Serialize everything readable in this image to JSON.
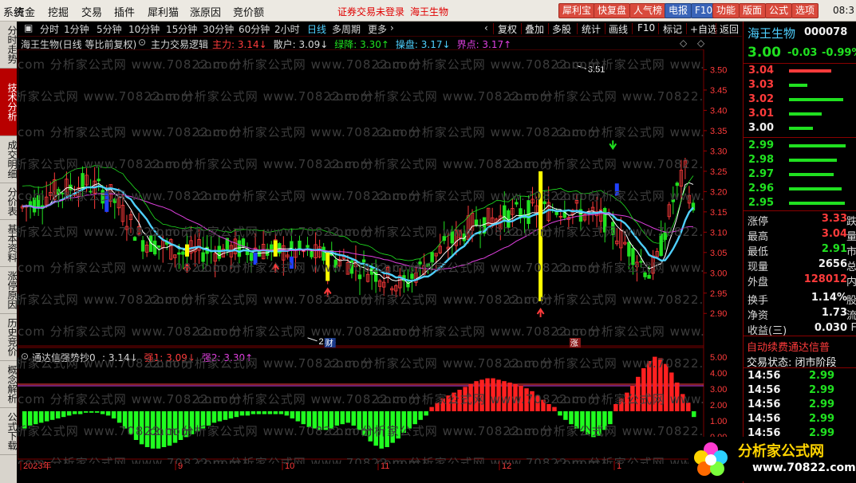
{
  "menubar": {
    "items": [
      "系统",
      "资金",
      "挖掘",
      "交易",
      "插件",
      "犀利猫",
      "涨原因",
      "竞价额"
    ],
    "login_notice": "证券交易未登录",
    "stock_name": "海王生物",
    "top_buttons": [
      "犀利宝",
      "快复盘",
      "人气榜",
      "电报",
      "F10",
      "功能",
      "版面",
      "公式",
      "选项"
    ],
    "clock": "08:3"
  },
  "left_tabs": [
    "分时走势",
    "技术分析",
    "成交明细",
    "分价表",
    "基本资料",
    "涨停原因",
    "历史竞价",
    "概念解析",
    "公式下载"
  ],
  "period_bar": {
    "periods": [
      "分时",
      "1分钟",
      "5分钟",
      "10分钟",
      "15分钟",
      "30分钟",
      "60分钟",
      "2小时",
      "日线",
      "多周期",
      "更多"
    ],
    "active": "日线",
    "right_buttons": [
      "复权",
      "叠加",
      "多股",
      "统计",
      "画线",
      "F10",
      "标记",
      "+自选",
      "返回"
    ]
  },
  "indicator_main": {
    "title": "海王生物(日线 等比前复权)",
    "formula": "主力交易逻辑",
    "items": [
      {
        "label": "主力:",
        "value": "3.14",
        "arrow": "↓",
        "color": "#ff3b3b"
      },
      {
        "label": "散户:",
        "value": "3.09",
        "arrow": "↓",
        "color": "#d8d8d8"
      },
      {
        "label": "绿降:",
        "value": "3.30",
        "arrow": "↑",
        "color": "#20e020"
      },
      {
        "label": "操盘:",
        "value": "3.17",
        "arrow": "↓",
        "color": "#4fd0ff"
      },
      {
        "label": "界点:",
        "value": "3.17",
        "arrow": "↑",
        "color": "#e040e0"
      }
    ]
  },
  "indicator_sub": {
    "formula": "通达信强势抄0",
    "items": [
      {
        "label": ":",
        "value": "3.14",
        "arrow": "↓",
        "color": "#d8d8d8"
      },
      {
        "label": "强1:",
        "value": "3.09",
        "arrow": "↓",
        "color": "#ff3b3b"
      },
      {
        "label": "强2:",
        "value": "3.30",
        "arrow": "↑",
        "color": "#e040e0"
      }
    ]
  },
  "price_axis": [
    "3.50",
    "3.45",
    "3.40",
    "3.35",
    "3.30",
    "3.25",
    "3.20",
    "3.15",
    "3.10",
    "3.05",
    "3.00",
    "2.95",
    "2.90"
  ],
  "sub_axis": [
    "5.00",
    "4.00",
    "3.00",
    "2.00",
    "1.00",
    "0.00"
  ],
  "date_axis": [
    "2023年",
    "9",
    "10",
    "11",
    "12",
    "1"
  ],
  "annotations": {
    "high_label": "3.51",
    "low_label": "2.84",
    "tag_cai": "财",
    "tag_zhang": "涨"
  },
  "watermark": "com 分析家公式网 www.70822.com",
  "quote": {
    "name": "海王生物",
    "code": "000078",
    "price": "3.00",
    "change": "-0.03",
    "pct": "-0.99%",
    "asks": [
      {
        "price": "3.04",
        "bar": 70
      },
      {
        "price": "3.03",
        "bar": 30
      },
      {
        "price": "3.02",
        "bar": 90
      },
      {
        "price": "3.01",
        "bar": 55
      },
      {
        "price": "3.00",
        "bar": 40
      }
    ],
    "bids": [
      {
        "price": "2.99",
        "bar": 95
      },
      {
        "price": "2.98",
        "bar": 80
      },
      {
        "price": "2.97",
        "bar": 75
      },
      {
        "price": "2.96",
        "bar": 88
      },
      {
        "price": "2.95",
        "bar": 93
      }
    ],
    "stats": [
      {
        "label": "涨停",
        "value": "3.33",
        "extra": "跌",
        "color": "#ff3b3b"
      },
      {
        "label": "最高",
        "value": "3.04",
        "extra": "量",
        "color": "#ff3b3b"
      },
      {
        "label": "最低",
        "value": "2.91",
        "extra": "市",
        "color": "#20e020"
      },
      {
        "label": "现量",
        "value": "2656",
        "extra": "总",
        "color": "#f0f0f0"
      },
      {
        "label": "外盘",
        "value": "128012",
        "extra": "内",
        "color": "#ff3b3b"
      },
      {
        "label": "换手",
        "value": "1.14%",
        "extra": "股",
        "color": "#f0f0f0"
      },
      {
        "label": "净资",
        "value": "1.73",
        "extra": "流",
        "color": "#f0f0f0"
      },
      {
        "label": "收益(三)",
        "value": "0.030",
        "extra": "F",
        "color": "#f0f0f0"
      }
    ],
    "promo": "自动续费通达信普",
    "trade_status": "交易状态: 闭市阶段",
    "ticks": [
      {
        "time": "14:56",
        "price": "2.99"
      },
      {
        "time": "14:56",
        "price": "2.99"
      },
      {
        "time": "14:56",
        "price": "2.99"
      },
      {
        "time": "14:56",
        "price": "2.99"
      },
      {
        "time": "14:56",
        "price": "2.99"
      },
      {
        "time": "14:56",
        "price": "2.99"
      }
    ]
  },
  "logo": {
    "text": "分析家公式网",
    "url": "www.70822.com"
  },
  "chart_data": {
    "type": "candlestick",
    "ylim": [
      2.84,
      3.51
    ],
    "sub_values": [
      -1.2,
      -1.0,
      -0.9,
      -0.8,
      -0.7,
      -0.6,
      -0.5,
      -0.4,
      -0.3,
      -0.2,
      -0.2,
      -0.1,
      -0.1,
      -0.1,
      -0.2,
      -0.3,
      -0.5,
      -0.8,
      -1.2,
      -1.6,
      -2.0,
      -2.3,
      -2.5,
      -2.6,
      -2.6,
      -2.5,
      -2.4,
      -2.2,
      -2.0,
      -1.8,
      -1.6,
      -1.4,
      -1.2,
      -1.0,
      -0.8,
      -0.7,
      -0.6,
      -0.5,
      -0.4,
      -0.3,
      -0.3,
      -0.2,
      -0.2,
      -0.2,
      -0.2,
      -0.2,
      -0.2,
      -0.3,
      -0.5,
      -0.7,
      -0.9,
      -1.1,
      -1.2,
      -1.3,
      -1.3,
      -1.2,
      -1.0,
      -0.9,
      -0.8,
      -1.0,
      -1.3,
      -1.7,
      -2.1,
      -2.4,
      -2.6,
      -2.5,
      -2.2,
      -1.9,
      -1.5,
      -1.2,
      -0.9,
      -0.6,
      -0.3,
      0.3,
      0.6,
      0.9,
      1.1,
      1.3,
      1.5,
      1.7,
      1.9,
      2.1,
      2.2,
      2.3,
      2.3,
      2.2,
      2.1,
      2.0,
      1.9,
      1.8,
      1.6,
      1.4,
      1.1,
      0.8,
      0.5,
      0.3,
      -0.3,
      -0.6,
      -0.9,
      -1.2,
      -1.4,
      -1.6,
      -1.8,
      -1.7,
      -1.3,
      -0.9,
      0.5,
      0.9,
      1.3,
      1.8,
      2.4,
      3.0,
      3.5,
      3.8,
      3.7,
      3.3,
      2.7,
      2.0,
      1.2,
      0.6,
      -0.4
    ]
  }
}
